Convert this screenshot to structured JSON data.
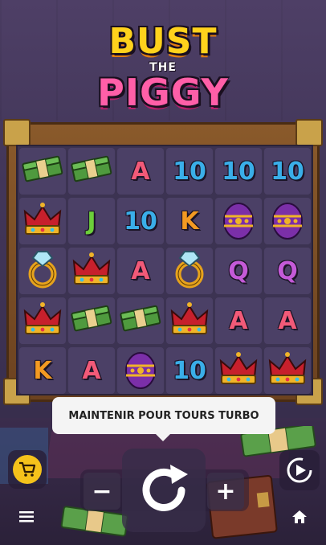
{
  "logo": {
    "line1": "BUST",
    "line2": "THE",
    "line3": "PIGGY"
  },
  "reels": {
    "grid": [
      [
        "cash",
        "cash",
        "A",
        "10",
        "10",
        "10"
      ],
      [
        "crown",
        "J",
        "10",
        "K",
        "egg",
        "egg"
      ],
      [
        "ring",
        "crown",
        "A",
        "ring",
        "Q",
        "Q"
      ],
      [
        "crown",
        "cash",
        "cash",
        "crown",
        "A",
        "A"
      ],
      [
        "K",
        "A",
        "egg",
        "10",
        "crown",
        "crown"
      ]
    ]
  },
  "colors": {
    "10": "#3aaee8",
    "A": "#f25a78",
    "J": "#6ccf3a",
    "K": "#f39a22",
    "Q": "#c45ad8"
  },
  "tooltip": {
    "text": "MAINTENIR POUR TOURS TURBO"
  },
  "controls": {
    "minus": "−",
    "plus": "+",
    "spin_icon": "spin-icon",
    "cart_icon": "cart-icon",
    "autoplay_icon": "autoplay-icon",
    "menu_icon": "menu-icon",
    "home_icon": "home-icon"
  }
}
